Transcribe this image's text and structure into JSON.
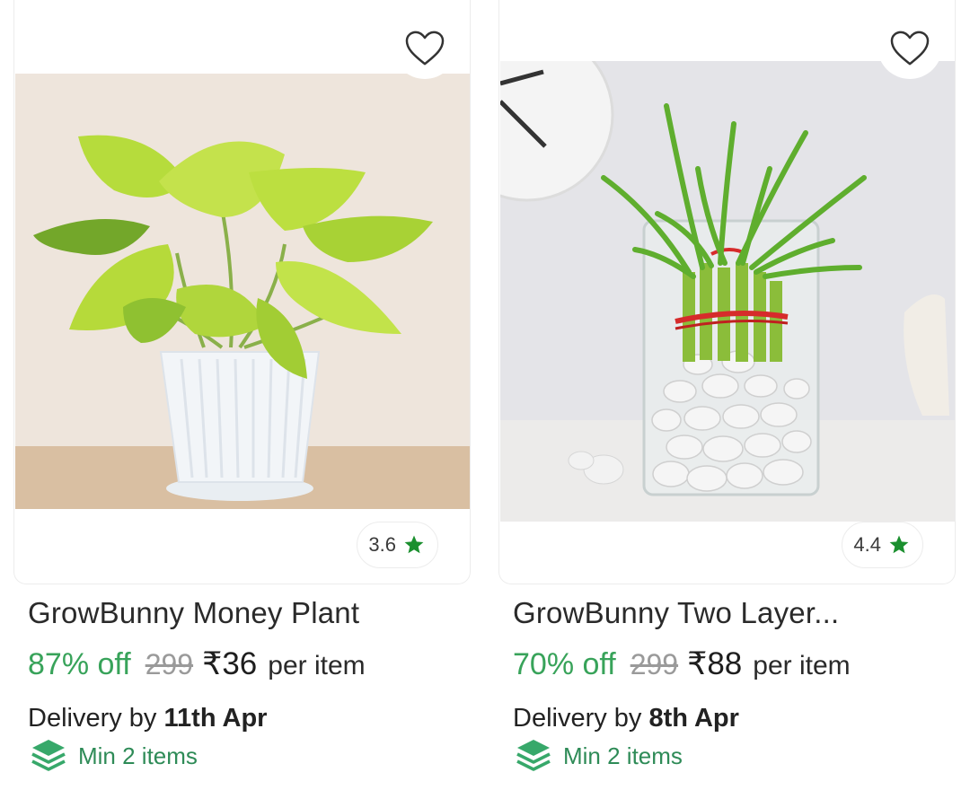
{
  "products": [
    {
      "name": "GrowBunny Money Plant",
      "rating": "3.6",
      "discount": "87% off",
      "mrp": "299",
      "price": "₹36",
      "per_item": "per item",
      "delivery_prefix": "Delivery by",
      "delivery_date": "11th Apr",
      "min_items": "Min 2 items"
    },
    {
      "name": "GrowBunny Two Layer...",
      "rating": "4.4",
      "discount": "70% off",
      "mrp": "299",
      "price": "₹88",
      "per_item": "per item",
      "delivery_prefix": "Delivery by",
      "delivery_date": "8th Apr",
      "min_items": "Min 2 items"
    }
  ],
  "icons": {
    "wishlist": "heart-outline-icon",
    "rating": "star-icon",
    "min_items": "layers-icon"
  },
  "colors": {
    "discount": "#38a35a",
    "star": "#1a8f2e",
    "min_items": "#2e8b57"
  }
}
